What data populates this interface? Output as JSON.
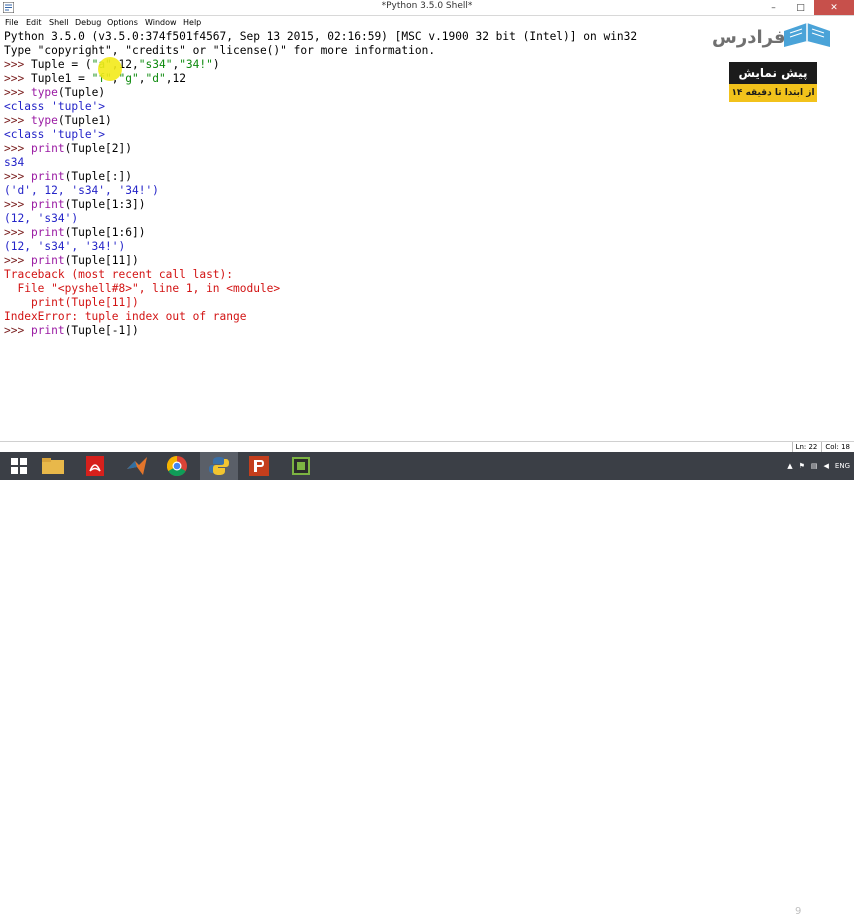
{
  "window": {
    "title": "*Python 3.5.0 Shell*",
    "controls": [
      "–",
      "□",
      "✕"
    ]
  },
  "menu": [
    "File",
    "Edit",
    "Shell",
    "Debug",
    "Options",
    "Window",
    "Help"
  ],
  "console": {
    "banner1": "Python 3.5.0 (v3.5.0:374f501f4567, Sep 13 2015, 02:16:59) [MSC v.1900 32 bit (Intel)] on win32",
    "banner2": "Type \"copyright\", \"credits\" or \"license()\" for more information.",
    "prompt": ">>> ",
    "l1": {
      "a": "Tuple = (",
      "b": "\"a\"",
      "c": ",12,",
      "d": "\"s34\"",
      "e": ",",
      "f": "\"34!\"",
      "g": ")"
    },
    "l2": {
      "a": "Tuple1 = ",
      "b": "\"f\"",
      "c": ",",
      "d": "\"g\"",
      "e": ",",
      "f": "\"d\"",
      "g": ",12"
    },
    "l3": {
      "fn": "type",
      "arg": "(Tuple)"
    },
    "o3": "<class 'tuple'>",
    "l4": {
      "fn": "type",
      "arg": "(Tuple1)"
    },
    "o4": "<class 'tuple'>",
    "l5": {
      "fn": "print",
      "arg": "(Tuple[2])"
    },
    "o5": "s34",
    "l6": {
      "fn": "print",
      "arg": "(Tuple[:])"
    },
    "o6": "('d', 12, 's34', '34!')",
    "l7": {
      "fn": "print",
      "arg": "(Tuple[1:3])"
    },
    "o7": "(12, 's34')",
    "l8": {
      "fn": "print",
      "arg": "(Tuple[1:6])"
    },
    "o8": "(12, 's34', '34!')",
    "l9": {
      "fn": "print",
      "arg": "(Tuple[11])"
    },
    "tb1": "Traceback (most recent call last):",
    "tb2": "  File \"<pyshell#8>\", line 1, in <module>",
    "tb3": "    print(Tuple[11])",
    "tb4": "IndexError: tuple index out of range",
    "l10": {
      "fn": "print",
      "arg": "(Tuple[-1])"
    }
  },
  "overlay": {
    "logo": "فرادرس",
    "preview_title": "پیش نمایش",
    "preview_sub": "از ابتدا تا دقیقه ۱۴"
  },
  "status": {
    "line": "Ln: 22",
    "col": "Col: 18"
  },
  "taskbar": {
    "items": [
      "windows-start",
      "file-explorer",
      "acrobat",
      "matlab",
      "chrome",
      "python-idle",
      "powerpoint",
      "camtasia"
    ],
    "active": "python-idle",
    "page_number": "9",
    "language": "ENG"
  },
  "colors": {
    "prompt": "#7a1f1f",
    "builtin": "#9a1aa3",
    "string": "#0d8a0d",
    "output": "#2424c8",
    "error": "#d21414",
    "taskbar": "#3b3f46"
  }
}
